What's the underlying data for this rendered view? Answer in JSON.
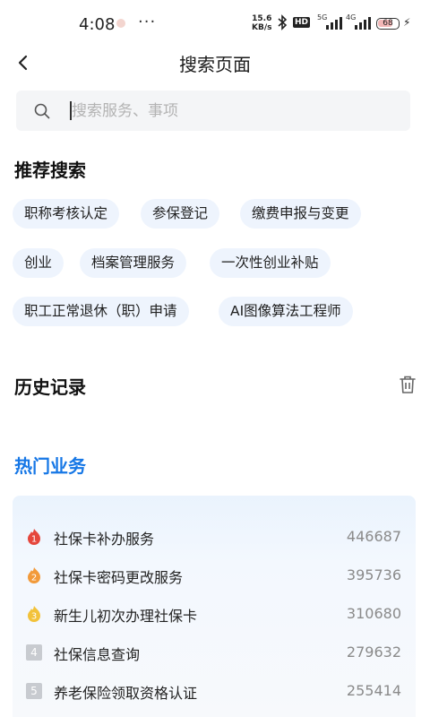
{
  "status_bar": {
    "time": "4:08",
    "more": "···",
    "net_speed_value": "15.6",
    "net_speed_unit": "KB/s",
    "hd_label": "HD",
    "net1": "5G",
    "net2": "4G",
    "battery": "68"
  },
  "header": {
    "title": "搜索页面"
  },
  "search": {
    "placeholder": "搜索服务、事项",
    "value": ""
  },
  "recommend": {
    "title": "推荐搜索",
    "tags": [
      "职称考核认定",
      "参保登记",
      "缴费申报与变更",
      "创业",
      "档案管理服务",
      "一次性创业补贴",
      "职工正常退休（职）申请",
      "AI图像算法工程师"
    ]
  },
  "history": {
    "title": "历史记录"
  },
  "hot": {
    "title": "热门业务",
    "accent": "#1677e6",
    "items": [
      {
        "rank": "1",
        "name": "社保卡补办服务",
        "count": "446687"
      },
      {
        "rank": "2",
        "name": "社保卡密码更改服务",
        "count": "395736"
      },
      {
        "rank": "3",
        "name": "新生儿初次办理社保卡",
        "count": "310680"
      },
      {
        "rank": "4",
        "name": "社保信息查询",
        "count": "279632"
      },
      {
        "rank": "5",
        "name": "养老保险领取资格认证",
        "count": "255414"
      }
    ]
  }
}
